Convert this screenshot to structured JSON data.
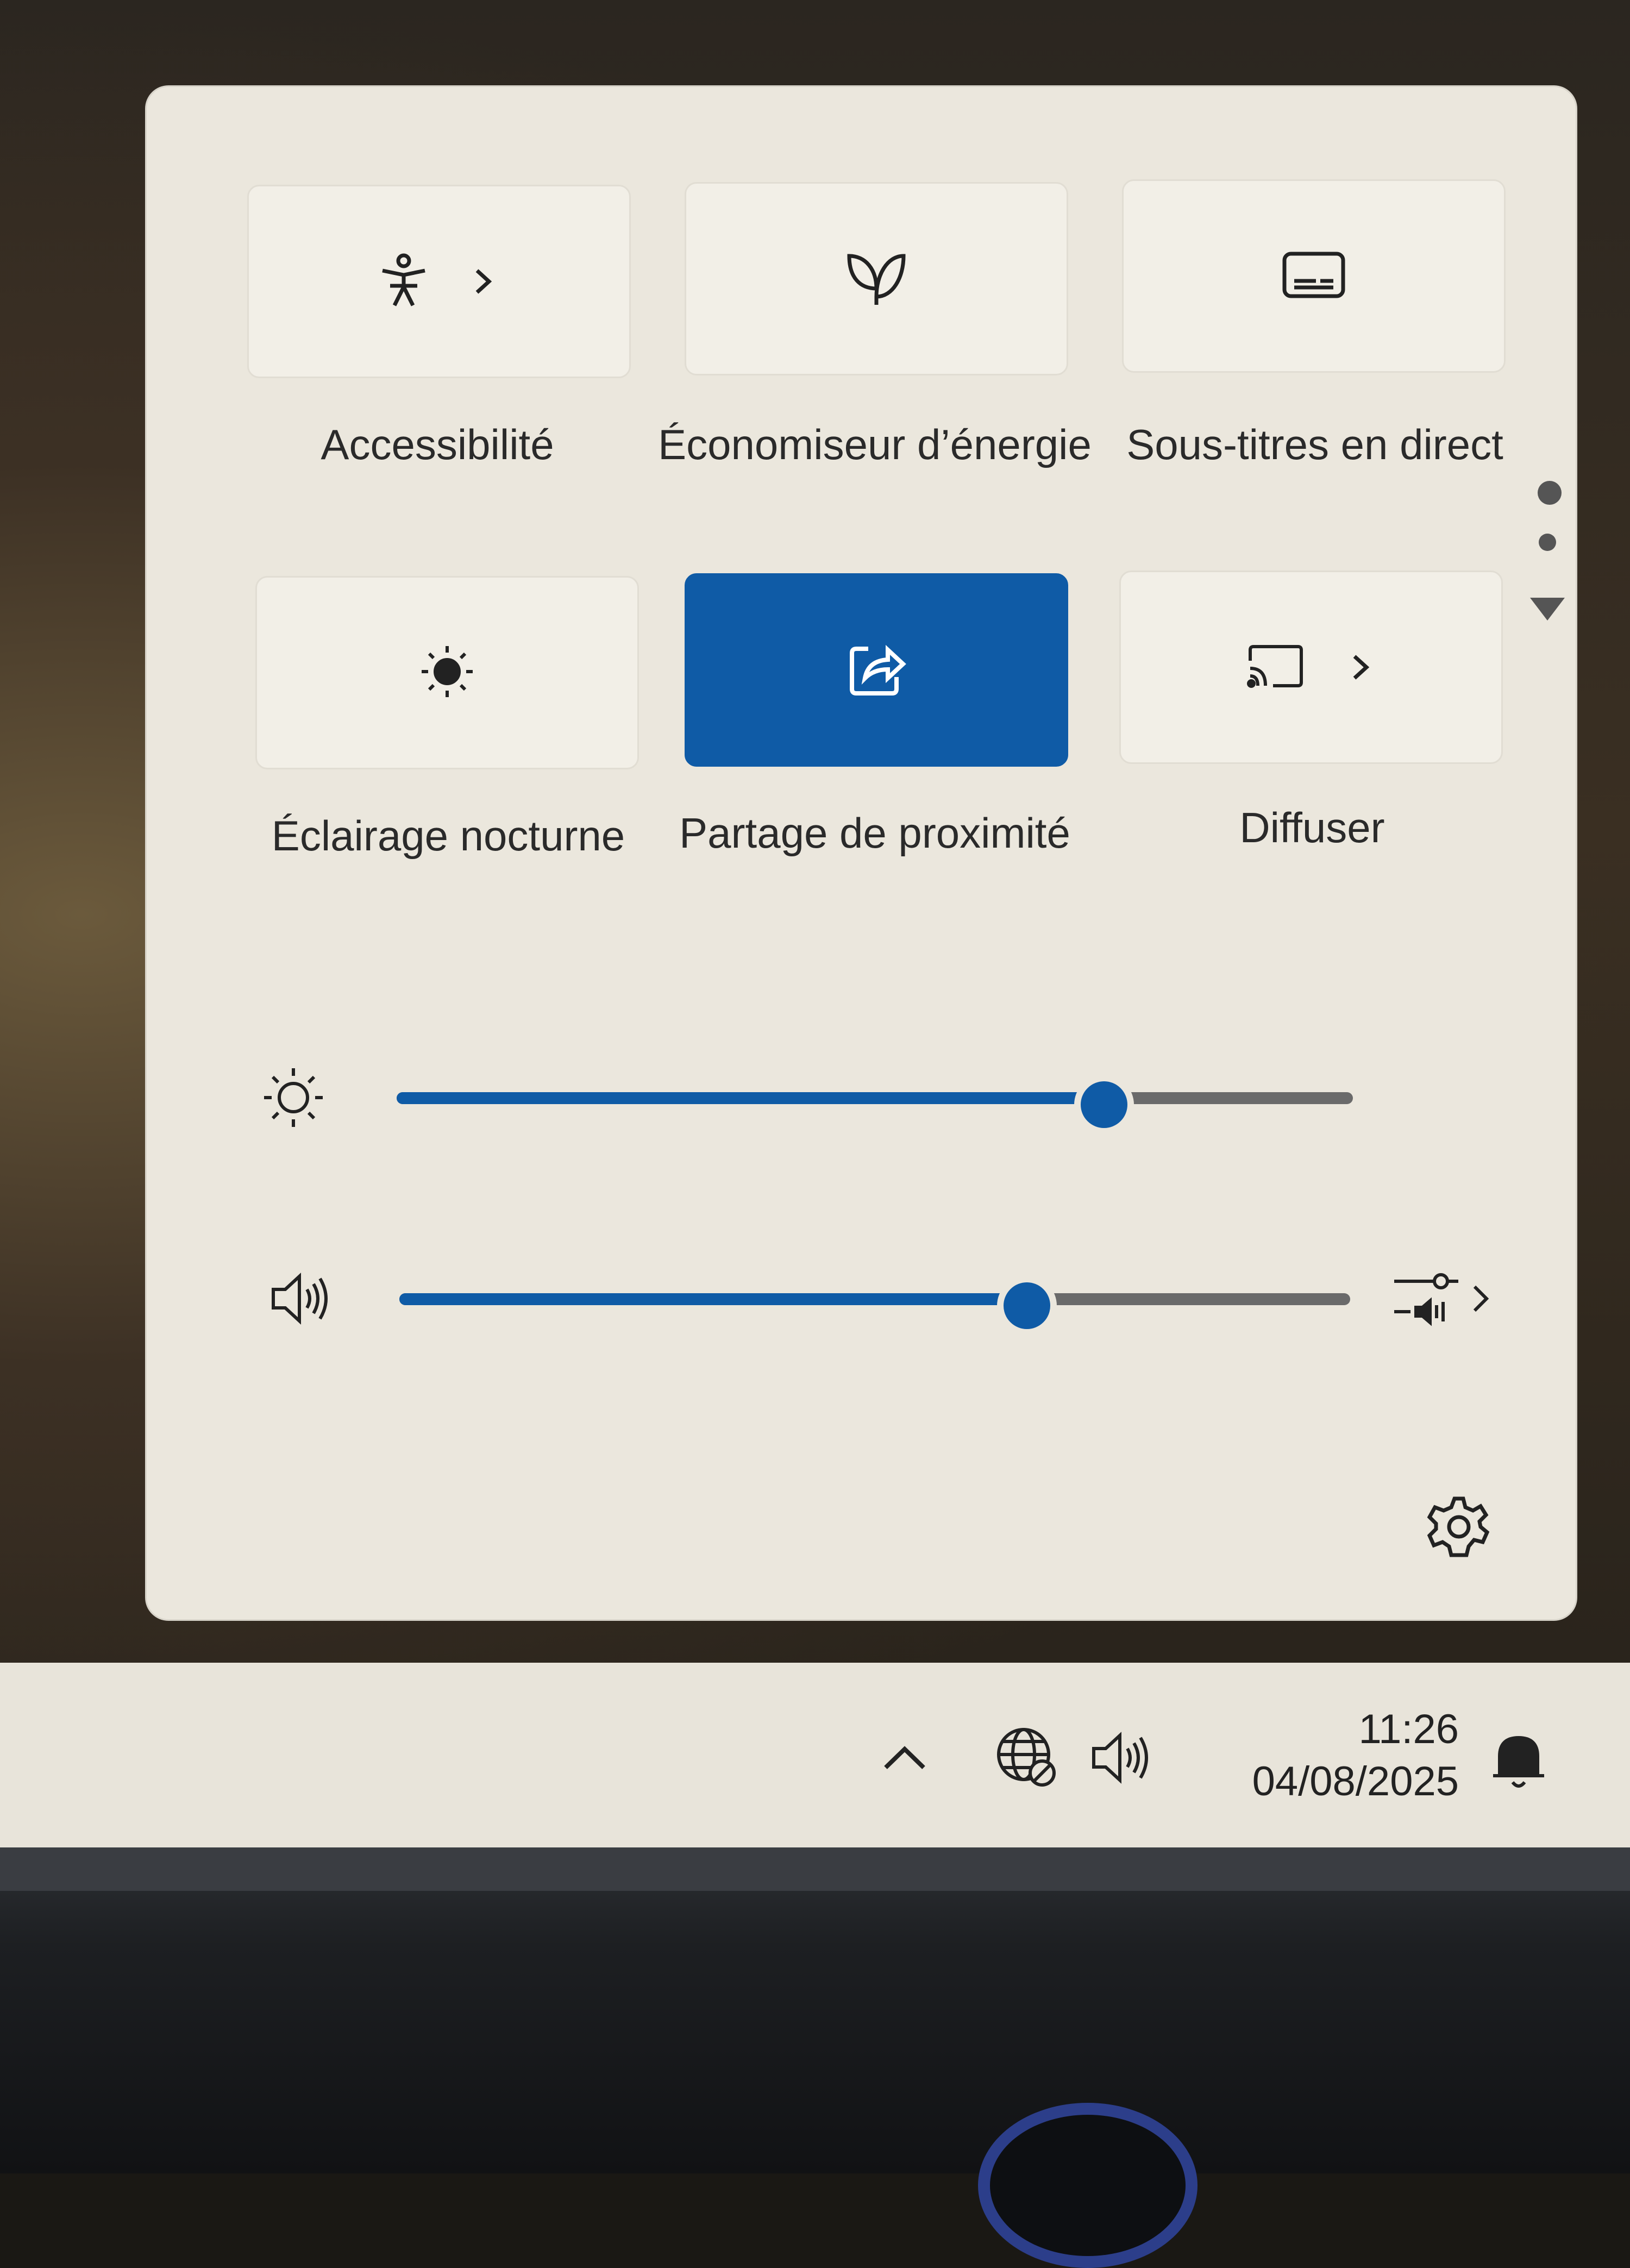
{
  "quick_settings": {
    "tiles": [
      {
        "label": "Accessibilité",
        "icon": "accessibility-icon",
        "has_chevron": true,
        "active": false
      },
      {
        "label": "Économiseur d’énergie",
        "icon": "energy-saver-leaf-icon",
        "has_chevron": false,
        "active": false
      },
      {
        "label": "Sous-titres en direct",
        "icon": "live-captions-icon",
        "has_chevron": false,
        "active": false
      },
      {
        "label": "Éclairage nocturne",
        "icon": "night-light-icon",
        "has_chevron": false,
        "active": false
      },
      {
        "label": "Partage de proximité",
        "icon": "nearby-share-icon",
        "has_chevron": false,
        "active": true
      },
      {
        "label": "Diffuser",
        "icon": "cast-icon",
        "has_chevron": true,
        "active": false
      }
    ],
    "brightness": {
      "icon": "brightness-sun-icon",
      "value": 0.74
    },
    "volume": {
      "icon": "speaker-icon",
      "value": 0.66,
      "output_icon": "audio-output-select-icon"
    },
    "settings_icon": "gear-icon",
    "colors": {
      "accent": "#0f5ba6",
      "panel": "#ebe7dd",
      "tile": "#f2efe7"
    }
  },
  "taskbar": {
    "time": "11:26",
    "date": "04/08/2025",
    "tray_icons": [
      "chevron-up-icon",
      "network-globe-icon",
      "speaker-icon",
      "notification-bell-icon"
    ]
  }
}
